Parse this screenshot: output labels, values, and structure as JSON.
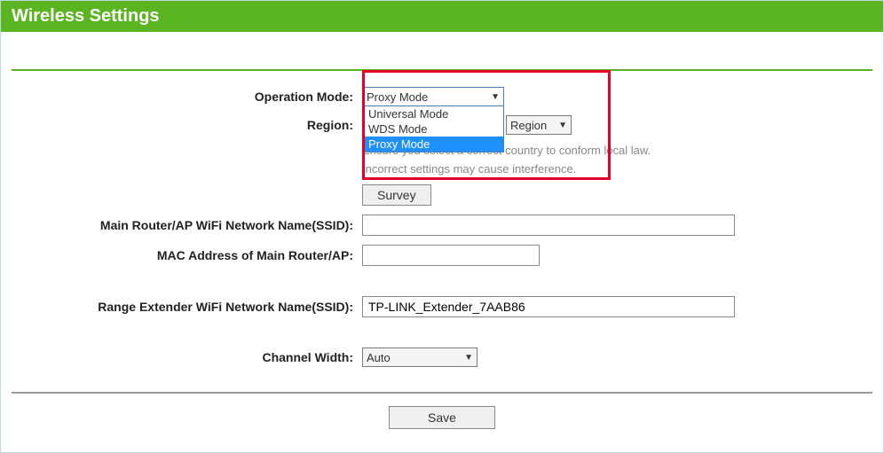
{
  "header": {
    "title": "Wireless Settings"
  },
  "operation_mode": {
    "label": "Operation Mode:",
    "selected": "Proxy Mode",
    "options": [
      "Universal Mode",
      "WDS Mode",
      "Proxy Mode"
    ],
    "highlighted_index": 2
  },
  "region": {
    "label": "Region:",
    "selected": "Region",
    "note": "Ensure you select a correct country to conform local law.",
    "note2": "Incorrect settings may cause interference."
  },
  "survey": {
    "label": "Survey"
  },
  "main_ssid": {
    "label": "Main Router/AP WiFi Network Name(SSID):",
    "value": ""
  },
  "main_mac": {
    "label": "MAC Address of Main Router/AP:",
    "value": ""
  },
  "ext_ssid": {
    "label": "Range Extender WiFi Network Name(SSID):",
    "value": "TP-LINK_Extender_7AAB86"
  },
  "channel_width": {
    "label": "Channel Width:",
    "selected": "Auto"
  },
  "save": {
    "label": "Save"
  }
}
